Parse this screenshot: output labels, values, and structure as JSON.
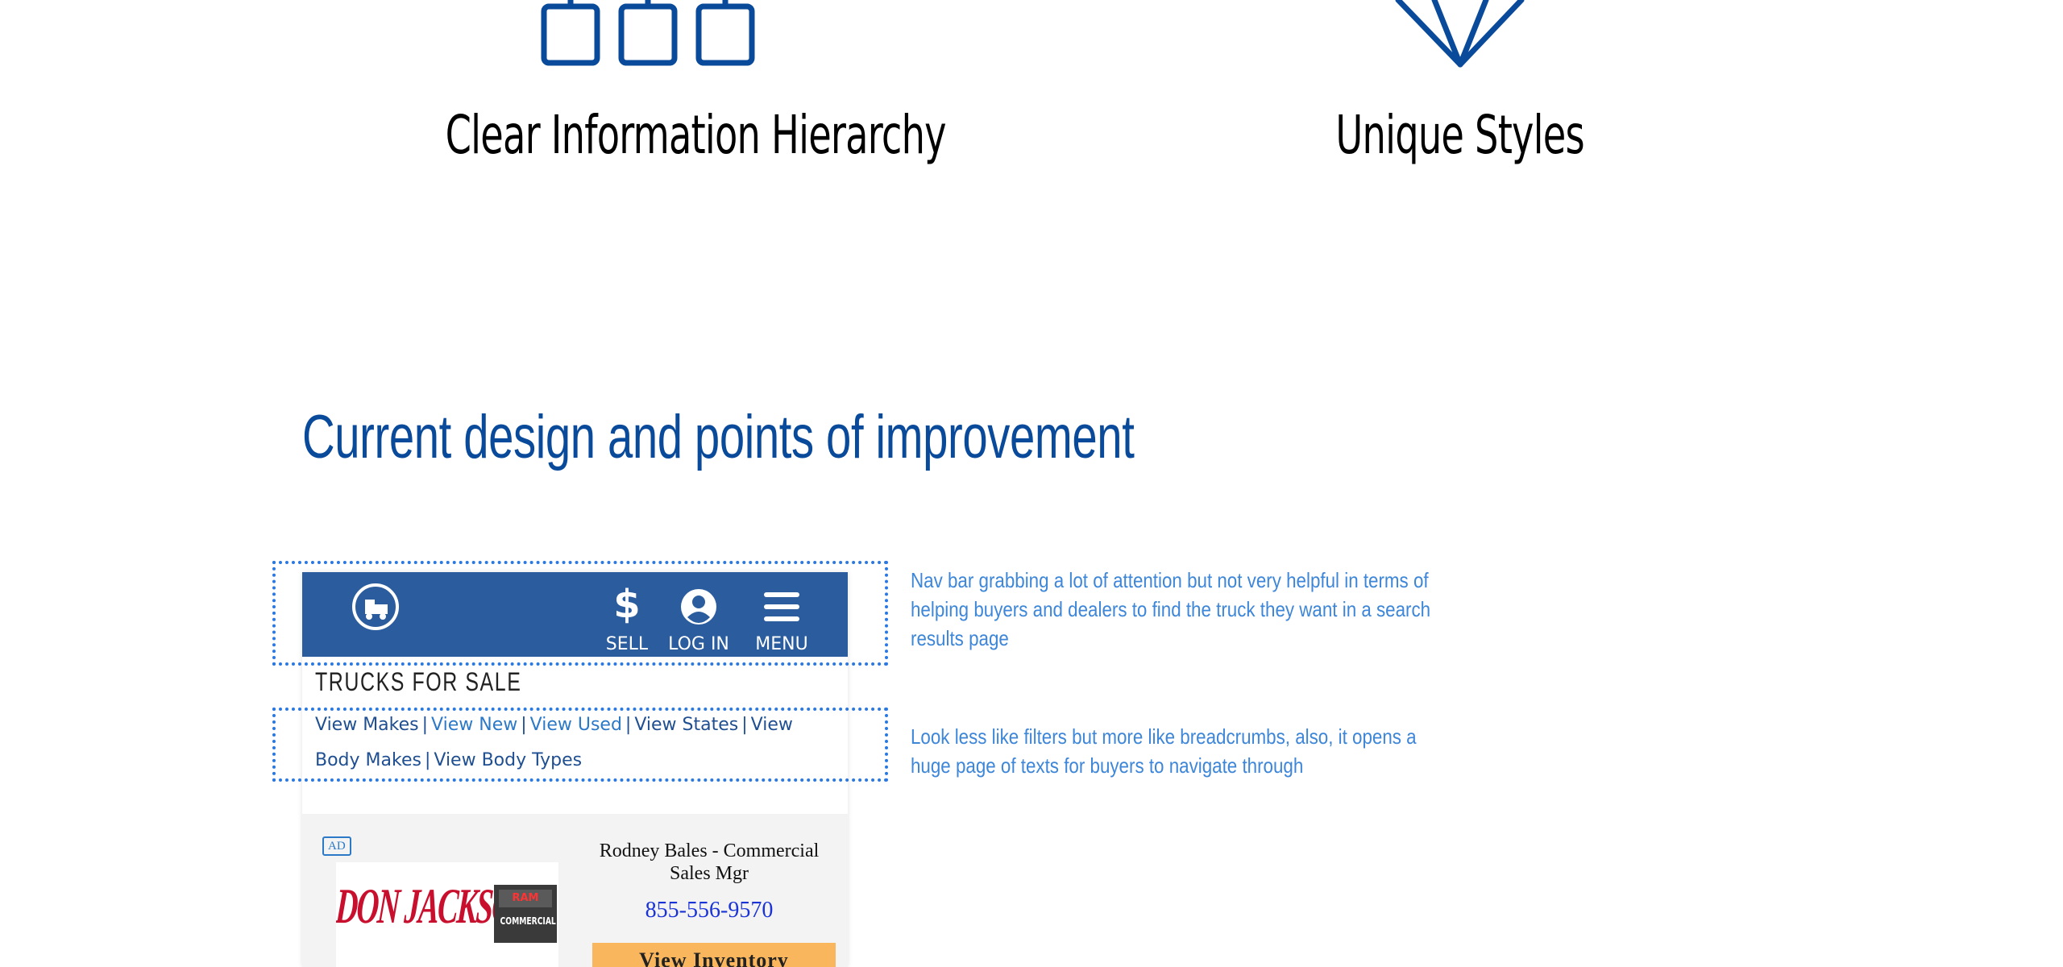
{
  "features": {
    "left": {
      "title": "Clear Information Hierarchy",
      "icon": "hierarchy-boxes-icon"
    },
    "right": {
      "title": "Unique Styles",
      "icon": "diamond-icon"
    }
  },
  "section": {
    "heading": "Current design and points of improvement"
  },
  "mockup": {
    "navbar": {
      "logo_icon": "truck-logo-icon",
      "sell_icon": "dollar-icon",
      "sell_label": "SELL",
      "login_icon": "user-circle-icon",
      "login_label": "LOG IN",
      "menu_icon": "hamburger-icon",
      "menu_label": "MENU",
      "background_color": "#2a5c9e"
    },
    "page_heading": "TRUCKS FOR SALE",
    "breadcrumbs": {
      "items": [
        "View Makes",
        "View New",
        "View Used",
        "View States",
        "View",
        "Body Makes",
        "View Body Types"
      ],
      "separator": "|"
    },
    "ad": {
      "badge": "AD",
      "dealer_logo_text": "DON JACKSON",
      "dealer_logo_badge_top": "RAM",
      "dealer_logo_badge_bottom": "COMMERCIAL",
      "contact_name": "Rodney Bales - Commercial Sales Mgr",
      "phone": "855-556-9570",
      "button_label": "View Inventory",
      "button_color": "#f9b65c"
    }
  },
  "annotations": {
    "nav": "Nav bar grabbing  a lot of attention but not very helpful in terms of helping buyers and dealers to find the truck they want in a search results page",
    "breadcrumbs": "Look less like filters but more like breadcrumbs, also, it opens a huge page of texts for buyers to navigate through"
  },
  "colors": {
    "accent": "#0a4a9a",
    "annotation": "#3d86d8",
    "callout_border": "#2b79e0"
  }
}
